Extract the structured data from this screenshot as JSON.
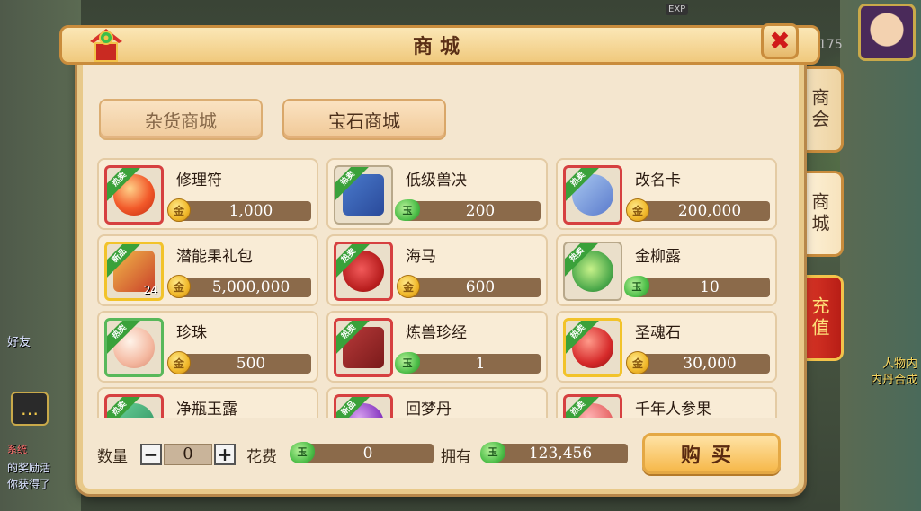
{
  "panel": {
    "title": "商城",
    "close_icon": "close-x-icon"
  },
  "background": {
    "exp_label": "EXP",
    "level_value": "175",
    "left_texts": [
      "好友",
      "系统",
      "的奖励活",
      "你获得了"
    ],
    "right_texts": [
      "人物内",
      "内丹合成"
    ]
  },
  "side_tabs": [
    {
      "label": "商会",
      "active": false
    },
    {
      "label": "商城",
      "active": true
    },
    {
      "label": "充值",
      "active": false,
      "style": "red"
    }
  ],
  "categories": [
    {
      "label": "杂货商城",
      "active": false
    },
    {
      "label": "宝石商城",
      "active": true
    }
  ],
  "items": [
    {
      "name": "修理符",
      "price": "1,000",
      "currency": "coin",
      "badge": "热卖",
      "icon": "red-orb-icon"
    },
    {
      "name": "低级兽决",
      "price": "200",
      "currency": "jade",
      "badge": "热卖",
      "icon": "blue-book-icon"
    },
    {
      "name": "改名卡",
      "price": "200,000",
      "currency": "coin",
      "badge": "热卖",
      "icon": "blue-card-icon"
    },
    {
      "name": "潜能果礼包",
      "price": "5,000,000",
      "currency": "coin",
      "badge": "新品",
      "icon": "gift-box-icon",
      "qty": "24"
    },
    {
      "name": "海马",
      "price": "600",
      "currency": "coin",
      "badge": "热卖",
      "icon": "seahorse-icon"
    },
    {
      "name": "金柳露",
      "price": "10",
      "currency": "jade",
      "badge": "热卖",
      "icon": "green-gourd-icon"
    },
    {
      "name": "珍珠",
      "price": "500",
      "currency": "coin",
      "badge": "热卖",
      "icon": "pearl-icon"
    },
    {
      "name": "炼兽珍经",
      "price": "1",
      "currency": "jade",
      "badge": "热卖",
      "icon": "scripture-book-icon"
    },
    {
      "name": "圣魂石",
      "price": "30,000",
      "currency": "coin",
      "badge": "热卖",
      "icon": "red-stone-icon"
    },
    {
      "name": "净瓶玉露",
      "price": "",
      "currency": "jade",
      "badge": "热卖",
      "icon": "jade-vase-icon"
    },
    {
      "name": "回梦丹",
      "price": "",
      "currency": "jade",
      "badge": "新品",
      "icon": "purple-pill-icon"
    },
    {
      "name": "千年人参果",
      "price": "",
      "currency": "jade",
      "badge": "热卖",
      "icon": "ginseng-fruit-icon"
    }
  ],
  "coin_glyph": "金",
  "jade_glyph": "玉",
  "bottom": {
    "quantity_label": "数量",
    "minus": "−",
    "plus": "+",
    "quantity_value": "0",
    "cost_label": "花费",
    "cost_value": "0",
    "owned_label": "拥有",
    "owned_value": "123,456",
    "buy_label": "购买"
  },
  "colors": {
    "panel_bg": "#f4e6cf",
    "price_bar": "#8b6a4a",
    "hot_badge": "#3aa13a",
    "recharge_tab": "#d62a1e"
  }
}
